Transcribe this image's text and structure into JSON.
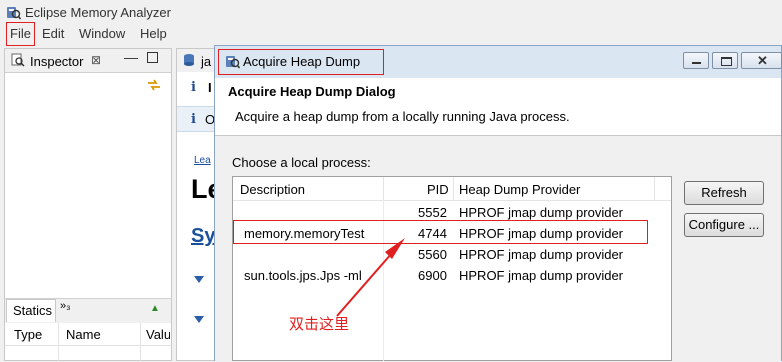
{
  "window": {
    "title": "Eclipse Memory Analyzer"
  },
  "menu": {
    "items": [
      "File",
      "Edit",
      "Window",
      "Help"
    ]
  },
  "inspector": {
    "tab_label": "Inspector",
    "close_glyph": "⊠",
    "min_glyph": "▭"
  },
  "bottom_panel": {
    "tab_label": "Statics",
    "more_tabs": "»₃",
    "columns": [
      "Type",
      "Name",
      "Value"
    ]
  },
  "editor": {
    "tab_text": "ja",
    "info_rows": [
      "i",
      "I",
      "i",
      "O"
    ],
    "link_text": "Lea",
    "big_text": "Le",
    "sys_text": "Sy"
  },
  "dialog": {
    "title": "Acquire Heap Dump",
    "heading": "Acquire Heap Dump Dialog",
    "description": "Acquire a heap dump from a locally running Java process.",
    "choose_label": "Choose a local process:",
    "columns": [
      "Description",
      "PID",
      "Heap Dump Provider"
    ],
    "rows": [
      {
        "description": "",
        "pid": "5552",
        "provider": "HPROF jmap dump provider"
      },
      {
        "description": "memory.memoryTest",
        "pid": "4744",
        "provider": "HPROF jmap dump provider"
      },
      {
        "description": "",
        "pid": "5560",
        "provider": "HPROF jmap dump provider"
      },
      {
        "description": "sun.tools.jps.Jps -ml",
        "pid": "6900",
        "provider": "HPROF jmap dump provider"
      }
    ],
    "buttons": {
      "refresh": "Refresh",
      "configure": "Configure ..."
    }
  },
  "annotation": {
    "text": "双击这里",
    "color": "#e02020"
  },
  "icons": [
    "eclipse-mat-icon",
    "inspector-icon",
    "link-arrows-icon",
    "database-icon",
    "info-icon",
    "pin-icon",
    "minimize-icon",
    "maximize-icon",
    "close-icon"
  ]
}
